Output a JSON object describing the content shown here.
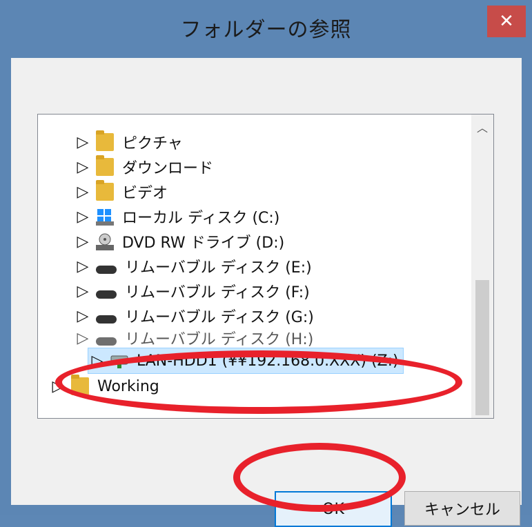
{
  "window": {
    "title": "フォルダーの参照"
  },
  "tree_items": [
    {
      "label": "ピクチャ",
      "icon": "pictures-folder-icon"
    },
    {
      "label": "ダウンロード",
      "icon": "downloads-folder-icon"
    },
    {
      "label": "ビデオ",
      "icon": "videos-folder-icon"
    },
    {
      "label": "ローカル ディスク (C:)",
      "icon": "windows-drive-icon"
    },
    {
      "label": "DVD RW ドライブ (D:)",
      "icon": "dvd-drive-icon"
    },
    {
      "label": "リムーバブル ディスク (E:)",
      "icon": "removable-drive-icon"
    },
    {
      "label": "リムーバブル ディスク (F:)",
      "icon": "removable-drive-icon"
    },
    {
      "label": "リムーバブル ディスク (G:)",
      "icon": "removable-drive-icon"
    },
    {
      "label": "リムーバブル ディスク (H:)",
      "icon": "removable-drive-icon"
    },
    {
      "label": "LAN-HDD1 (¥¥192.168.0.XXX) (Z:)",
      "icon": "network-drive-icon",
      "selected": true
    },
    {
      "label": "Working",
      "icon": "folder-icon"
    }
  ],
  "buttons": {
    "ok": "OK",
    "cancel": "キャンセル"
  },
  "glyphs": {
    "close": "✕",
    "expand": "▷",
    "scroll_up": "︿"
  },
  "colors": {
    "titlebar": "#5c86b4",
    "close": "#c74c49",
    "selection": "#cce8ff",
    "highlight_ring": "#e8212b"
  }
}
